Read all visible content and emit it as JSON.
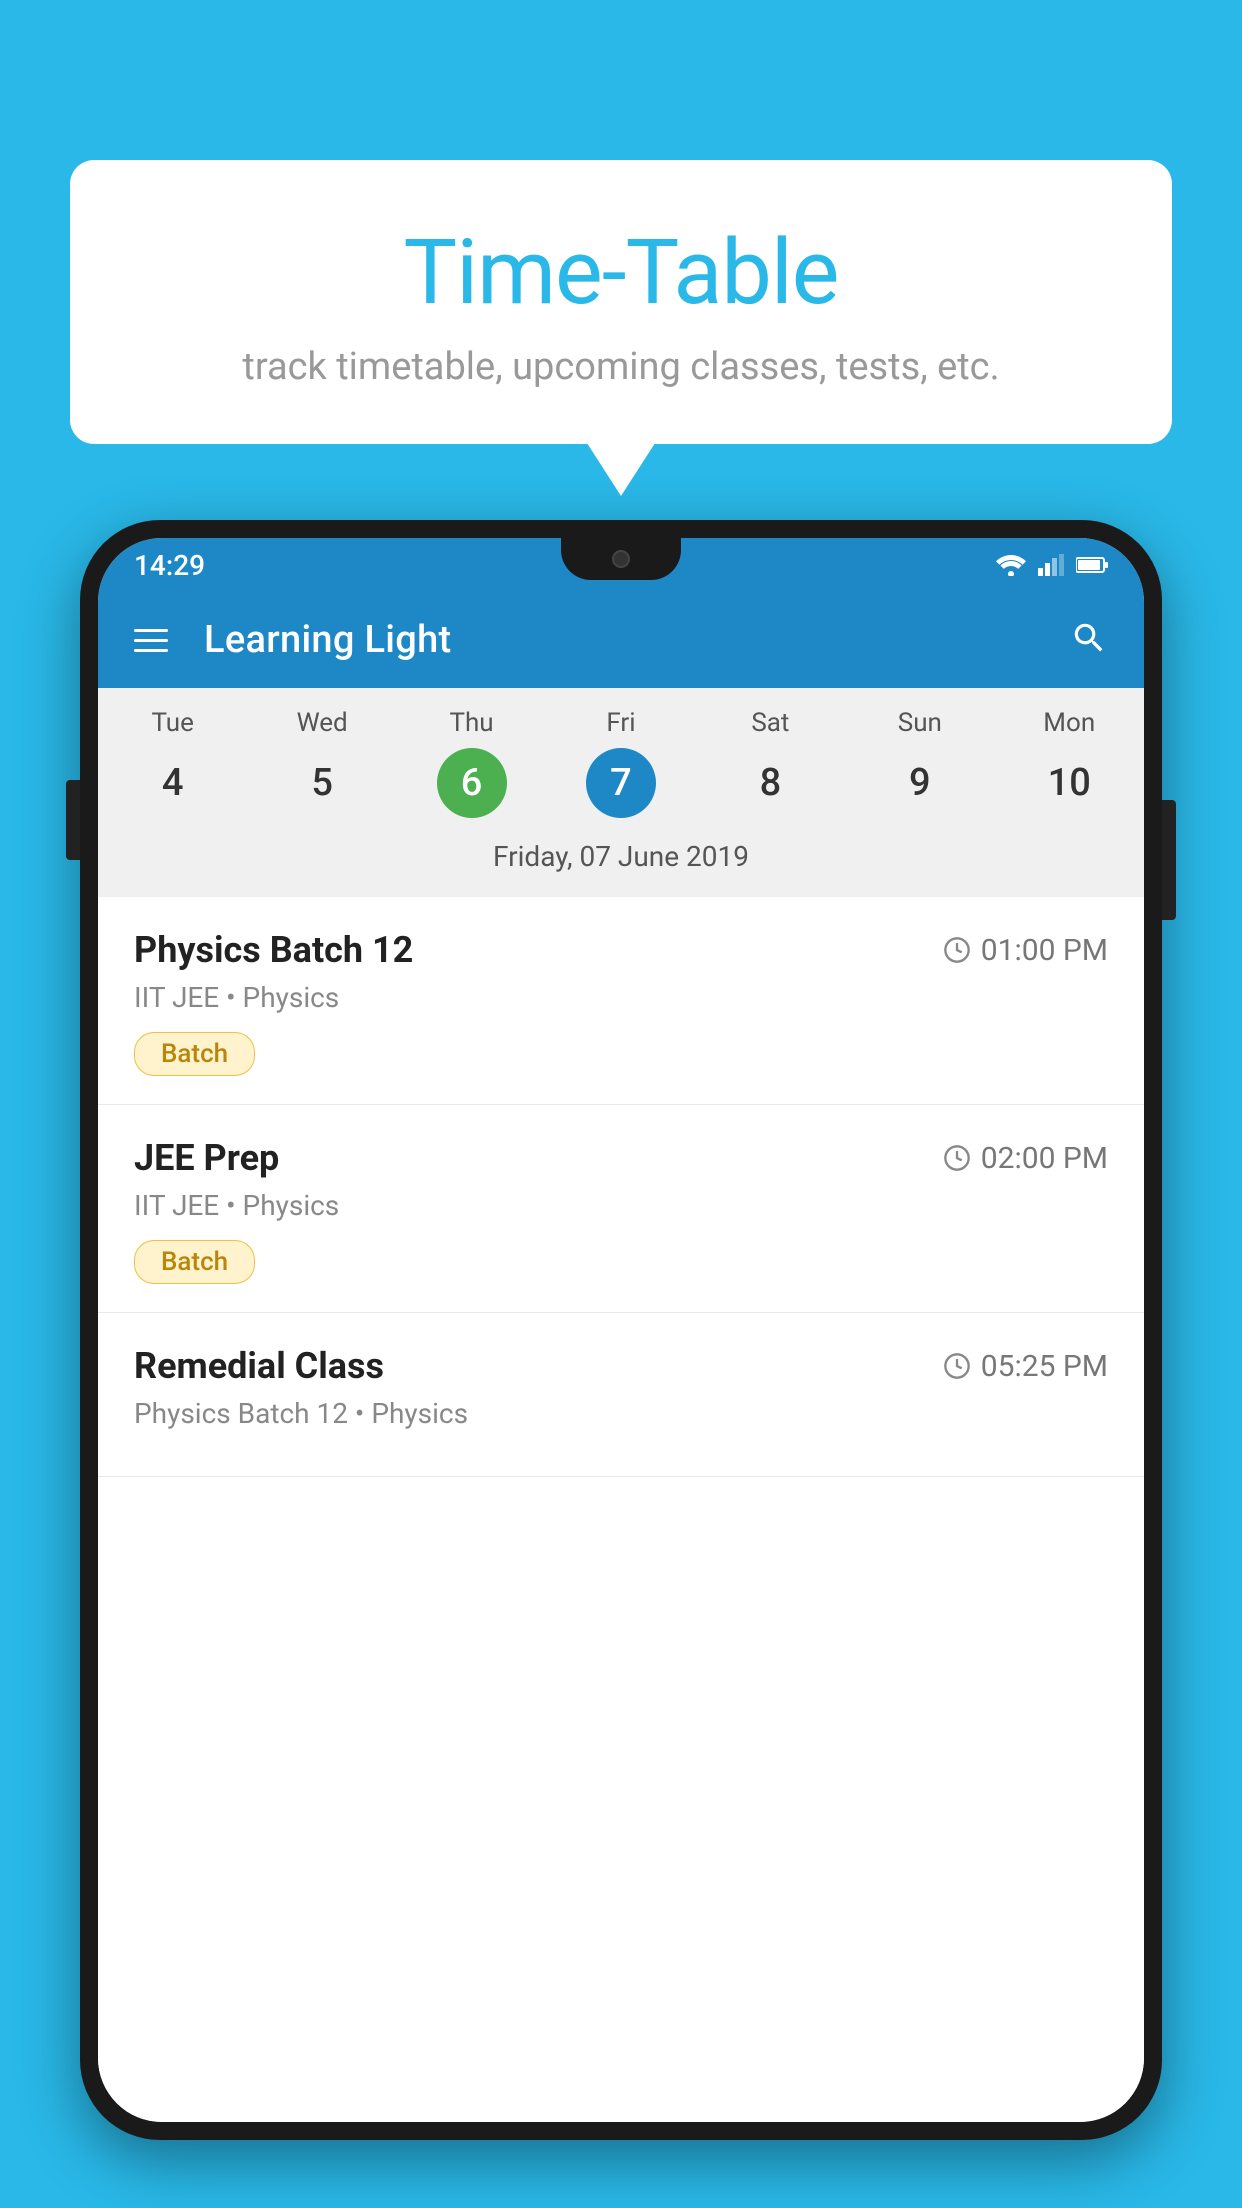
{
  "background_color": "#29b8e8",
  "bubble": {
    "title": "Time-Table",
    "subtitle": "track timetable, upcoming classes, tests, etc."
  },
  "phone": {
    "status_bar": {
      "time": "14:29"
    },
    "app_bar": {
      "title": "Learning Light"
    },
    "calendar": {
      "days": [
        "Tue",
        "Wed",
        "Thu",
        "Fri",
        "Sat",
        "Sun",
        "Mon"
      ],
      "dates": [
        "4",
        "5",
        "6",
        "7",
        "8",
        "9",
        "10"
      ],
      "today_index": 2,
      "selected_index": 3,
      "selected_label": "Friday, 07 June 2019"
    },
    "schedule": [
      {
        "title": "Physics Batch 12",
        "time": "01:00 PM",
        "meta": "IIT JEE • Physics",
        "tag": "Batch"
      },
      {
        "title": "JEE Prep",
        "time": "02:00 PM",
        "meta": "IIT JEE • Physics",
        "tag": "Batch"
      },
      {
        "title": "Remedial Class",
        "time": "05:25 PM",
        "meta": "Physics Batch 12 • Physics",
        "tag": ""
      }
    ]
  }
}
